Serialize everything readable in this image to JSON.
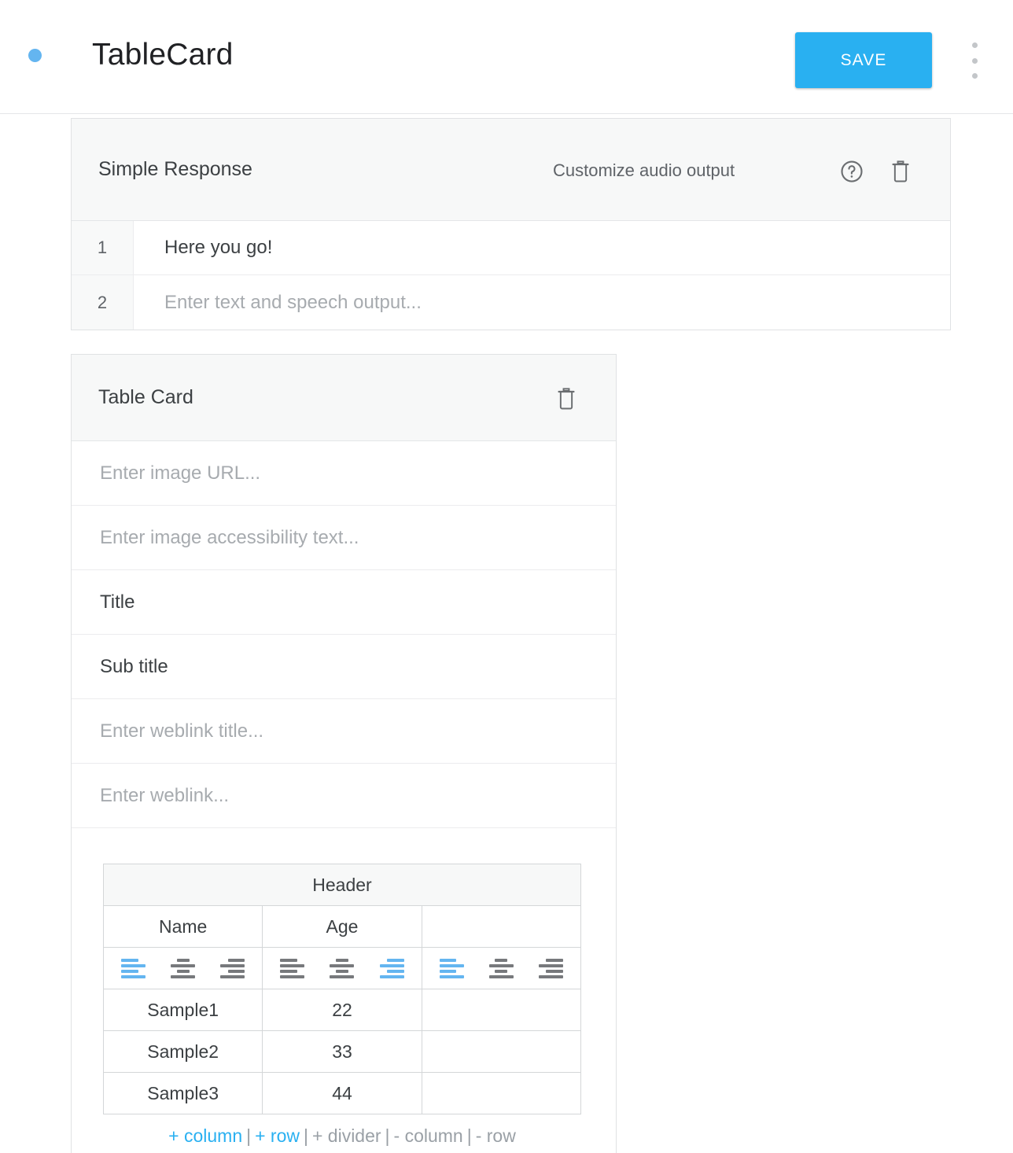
{
  "topbar": {
    "status_dot": "status-dot",
    "title": "TableCard",
    "save_label": "SAVE",
    "menu_icon": "kebab-menu-icon"
  },
  "simple_response": {
    "title": "Simple Response",
    "audio_label": "Customize audio output",
    "help_icon": "help-icon",
    "delete_icon": "trash-icon",
    "rows": [
      {
        "num": "1",
        "value": "Here you go!",
        "is_placeholder": false
      },
      {
        "num": "2",
        "value": "Enter text and speech output...",
        "is_placeholder": true
      }
    ]
  },
  "table_card": {
    "title": "Table Card",
    "delete_icon": "trash-icon",
    "fields": [
      {
        "name": "image-url",
        "value": "Enter image URL...",
        "is_placeholder": true
      },
      {
        "name": "image-accessibility-text",
        "value": "Enter image accessibility text...",
        "is_placeholder": true
      },
      {
        "name": "title",
        "value": "Title",
        "is_placeholder": false
      },
      {
        "name": "sub-title",
        "value": "Sub title",
        "is_placeholder": false
      },
      {
        "name": "weblink-title",
        "value": "Enter weblink title...",
        "is_placeholder": true
      },
      {
        "name": "weblink",
        "value": "Enter weblink...",
        "is_placeholder": true
      }
    ],
    "grid": {
      "header_label": "Header",
      "column_labels": [
        "Name",
        "Age",
        ""
      ],
      "alignments": [
        "left",
        "right",
        "left"
      ],
      "alignment_options": [
        "left",
        "center",
        "right"
      ],
      "rows": [
        [
          "Sample1",
          "22",
          ""
        ],
        [
          "Sample2",
          "33",
          ""
        ],
        [
          "Sample3",
          "44",
          ""
        ]
      ]
    },
    "actions": {
      "add_column": "+ column",
      "add_row": "+ row",
      "add_divider": "+ divider",
      "remove_column": "- column",
      "remove_row": "- row",
      "separator": "|"
    }
  },
  "colors": {
    "accent": "#29b0f1",
    "accent_light": "#64b5f0",
    "text": "#3c4043",
    "placeholder": "#a7abaf",
    "muted": "#9aa0a6",
    "panel": "#f7f8f8",
    "border": "#e0e2e4"
  }
}
